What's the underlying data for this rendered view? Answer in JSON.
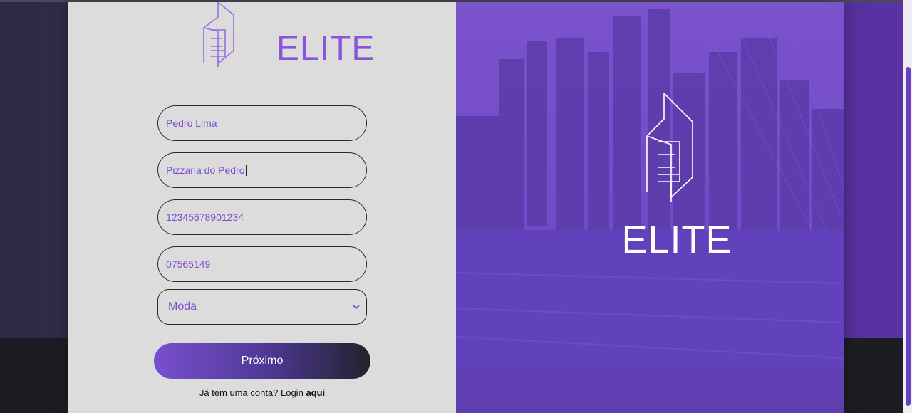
{
  "brand": {
    "name": "ELITE"
  },
  "form": {
    "name_value": "Pedro Lima",
    "company_value": "Pizzaria do Pedro",
    "document_value": "12345678901234",
    "cep_value": "07565149",
    "category_selected": "Moda",
    "next_label": "Próximo",
    "login_prompt": "Já tem uma conta? Login",
    "login_link": "aqui"
  },
  "colors": {
    "accent": "#8a55d8",
    "panel_purple": "#6a45c4",
    "form_bg": "#dcdcdd"
  }
}
